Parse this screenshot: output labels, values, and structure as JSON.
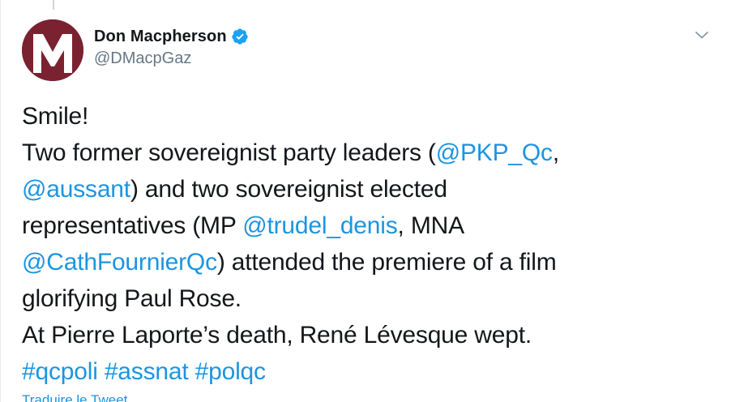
{
  "user": {
    "display_name": "Don Macpherson",
    "handle": "@DMacpGaz",
    "avatar_letter": "M",
    "verified": true
  },
  "tweet": {
    "line1": "Smile!",
    "line2_text": "Two former sovereignist party leaders (",
    "mention_pkp": "@PKP_Qc",
    "line2_end": ",",
    "mention_aussant": "@aussant",
    "line3_text": ") and two sovereignist elected",
    "line4_text": "representatives (MP ",
    "mention_trudel": "@trudel_denis",
    "line4_end": ", MNA",
    "mention_cath": "@CathFournierQc",
    "line5_text": ") attended the premiere of a film",
    "line6": "glorifying Paul Rose.",
    "line7": "At Pierre Laporte’s death, René Lévesque wept.",
    "hashtag_qcpoli": "#qcpoli",
    "hashtag_assnat": "#assnat",
    "hashtag_polqc": "#polqc"
  },
  "actions": {
    "translate_label": "Traduire le Tweet",
    "menu_icon": "chevron-down-icon"
  },
  "colors": {
    "link": "#1b95e0",
    "text": "#14171a",
    "secondary": "#657786",
    "avatar_bg": "#7a2230",
    "verified": "#1da1f2"
  }
}
